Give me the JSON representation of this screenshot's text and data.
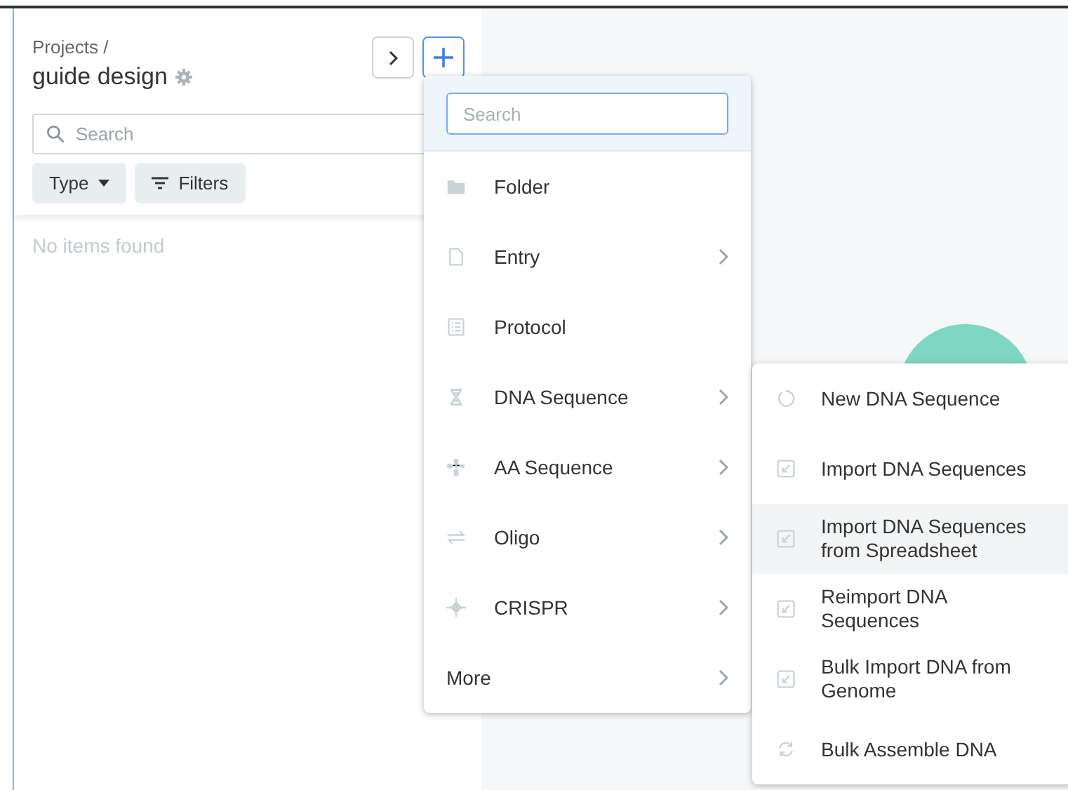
{
  "panel": {
    "breadcrumb": "Projects /",
    "title": "guide design",
    "search": {
      "placeholder": "Search"
    },
    "filters": [
      {
        "kind": "dropdown",
        "label": "Type"
      },
      {
        "kind": "filter",
        "label": "Filters"
      }
    ],
    "empty_message": "No items found"
  },
  "create_menu": {
    "search": {
      "placeholder": "Search"
    },
    "items": [
      {
        "kind": "folder",
        "label": "Folder",
        "submenu": false
      },
      {
        "kind": "file",
        "label": "Entry",
        "submenu": true
      },
      {
        "kind": "list",
        "label": "Protocol",
        "submenu": false
      },
      {
        "kind": "dna",
        "label": "DNA Sequence",
        "submenu": true
      },
      {
        "kind": "aa",
        "label": "AA Sequence",
        "submenu": true
      },
      {
        "kind": "oligo",
        "label": "Oligo",
        "submenu": true
      },
      {
        "kind": "crispr",
        "label": "CRISPR",
        "submenu": true
      },
      {
        "kind": "none",
        "label": "More",
        "submenu": true
      }
    ]
  },
  "dna_submenu": {
    "items": [
      {
        "kind": "new",
        "label": "New DNA Sequence",
        "hovered": false
      },
      {
        "kind": "import",
        "label": "Import DNA Sequences",
        "hovered": false
      },
      {
        "kind": "import",
        "label": "Import DNA Sequences from Spreadsheet",
        "hovered": true
      },
      {
        "kind": "import",
        "label": "Reimport DNA Sequences",
        "hovered": false
      },
      {
        "kind": "import",
        "label": "Bulk Import DNA from Genome",
        "hovered": false
      },
      {
        "kind": "refresh",
        "label": "Bulk Assemble DNA",
        "hovered": false
      }
    ]
  }
}
